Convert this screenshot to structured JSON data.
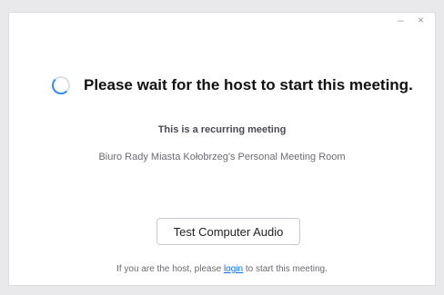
{
  "window": {
    "minimize_glyph": "–",
    "close_glyph": "×"
  },
  "main": {
    "headline": "Please wait for the host to start this meeting.",
    "recurring": "This is a recurring meeting",
    "room_name": "Biuro Rady Miasta Kołobrzeg's Personal Meeting Room",
    "spinner_icon": "loading-spinner-icon",
    "test_audio_label": "Test Computer Audio"
  },
  "footer": {
    "prefix": "If you are the host, please ",
    "login_link": "login",
    "suffix": " to start this meeting."
  },
  "colors": {
    "accent": "#2d8cff",
    "link": "#0e71eb"
  }
}
